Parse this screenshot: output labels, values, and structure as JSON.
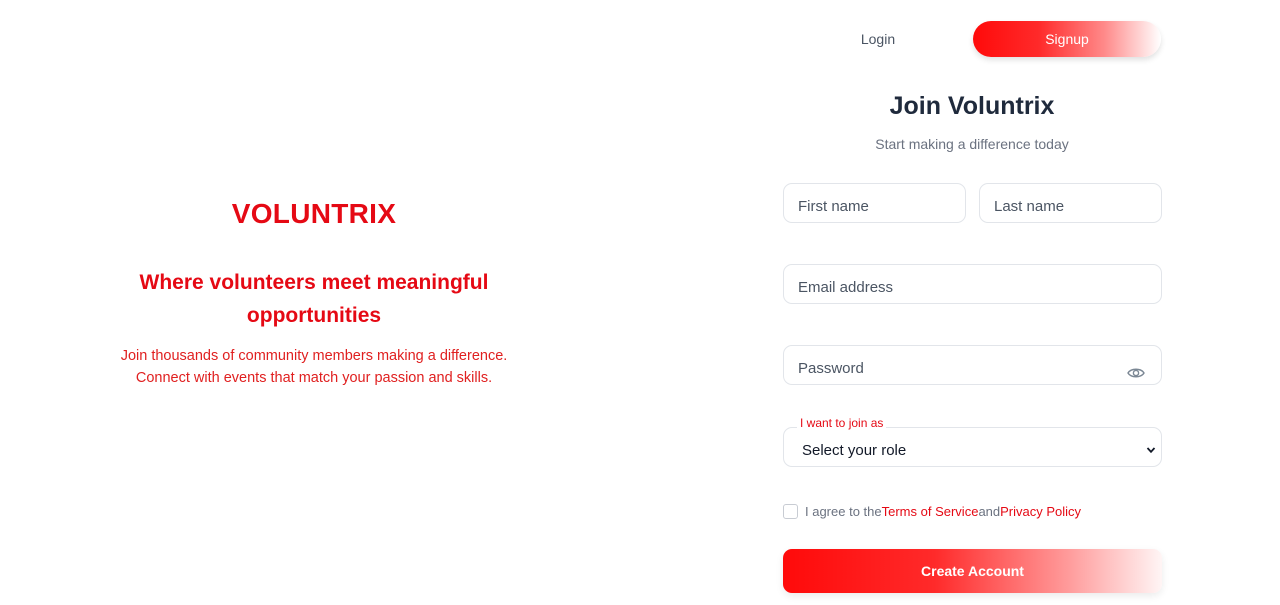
{
  "hero": {
    "brand": "VOLUNTRIX",
    "tagline": "Where volunteers meet meaningful opportunities",
    "blurb_line1": "Join thousands of community members making a difference.",
    "blurb_line2": "Connect with events that match your passion and skills."
  },
  "tabs": {
    "login": "Login",
    "signup": "Signup",
    "active": "signup"
  },
  "form": {
    "title": "Join Voluntrix",
    "subtitle": "Start making a difference today",
    "first_name_placeholder": "First name",
    "last_name_placeholder": "Last name",
    "email_placeholder": "Email address",
    "password_placeholder": "Password",
    "password_toggle_icon": "eye-icon",
    "role_label": "I want to join as",
    "role_value": "Select your role",
    "agree_prefix": "I agree to the",
    "terms_link": "Terms of Service",
    "agree_and": "and",
    "privacy_link": "Privacy Policy",
    "agree_checked": false,
    "submit_label": "Create Account"
  },
  "colors": {
    "accent": "#e50914",
    "heading": "#1f2a3c",
    "muted": "#6b7280"
  }
}
